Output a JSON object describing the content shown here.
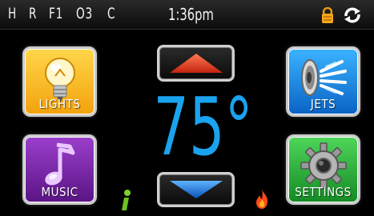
{
  "status": {
    "codes": [
      "H",
      "R",
      "F1",
      "O3",
      "C"
    ],
    "time": "1:36pm"
  },
  "tiles": {
    "lights": "LIGHTS",
    "music": "MUSIC",
    "jets": "JETS",
    "settings": "SETTINGS"
  },
  "temperature": "75°",
  "colors": {
    "temperature": "#1aa3ee",
    "lights": "#f7b41a",
    "music": "#7a2aa8",
    "jets": "#1a7fe0",
    "settings": "#2fb23d",
    "up_arrow": "#e04a2a",
    "down_arrow": "#1a6fd0"
  },
  "icons": {
    "lock": "lock-icon",
    "sync": "sync-icon",
    "info": "info-icon",
    "flame": "flame-icon",
    "lightbulb": "lightbulb-icon",
    "music_note": "music-note-icon",
    "jets": "jets-icon",
    "gear": "gear-icon"
  }
}
